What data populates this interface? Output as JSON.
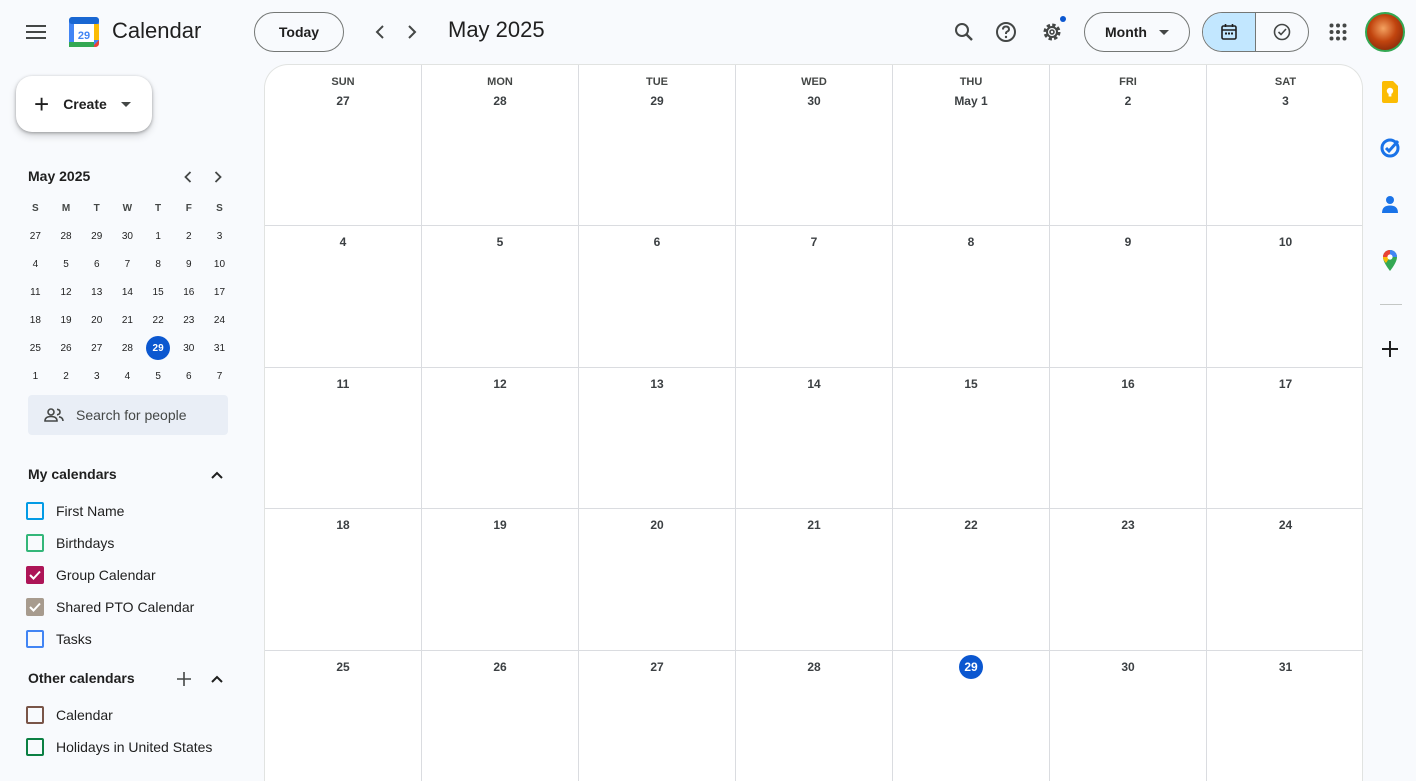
{
  "header": {
    "app_title": "Calendar",
    "logo_day": "29",
    "today_label": "Today",
    "month_title": "May 2025",
    "view_label": "Month",
    "colors": {
      "accent": "#0b57d0",
      "toggle_active": "#c2e7ff"
    }
  },
  "sidebar": {
    "create_label": "Create",
    "mini_calendar": {
      "title": "May 2025",
      "weekdays": [
        "S",
        "M",
        "T",
        "W",
        "T",
        "F",
        "S"
      ],
      "days": [
        "27",
        "28",
        "29",
        "30",
        "1",
        "2",
        "3",
        "4",
        "5",
        "6",
        "7",
        "8",
        "9",
        "10",
        "11",
        "12",
        "13",
        "14",
        "15",
        "16",
        "17",
        "18",
        "19",
        "20",
        "21",
        "22",
        "23",
        "24",
        "25",
        "26",
        "27",
        "28",
        "29",
        "30",
        "31",
        "1",
        "2",
        "3",
        "4",
        "5",
        "6",
        "7"
      ],
      "selected_index": 32
    },
    "people_search_placeholder": "Search for people",
    "my_calendars": {
      "title": "My calendars",
      "items": [
        {
          "label": "First Name",
          "color": "#039be5",
          "checked": false
        },
        {
          "label": "Birthdays",
          "color": "#33b679",
          "checked": false
        },
        {
          "label": "Group Calendar",
          "color": "#ad1457",
          "checked": true
        },
        {
          "label": "Shared PTO Calendar",
          "color": "#a79b8e",
          "checked": true
        },
        {
          "label": "Tasks",
          "color": "#4285f4",
          "checked": false
        }
      ]
    },
    "other_calendars": {
      "title": "Other calendars",
      "items": [
        {
          "label": "Calendar",
          "color": "#795548",
          "checked": false
        },
        {
          "label": "Holidays in United States",
          "color": "#0b8043",
          "checked": false
        }
      ]
    }
  },
  "month_grid": {
    "weekdays": [
      "SUN",
      "MON",
      "TUE",
      "WED",
      "THU",
      "FRI",
      "SAT"
    ],
    "weeks": [
      [
        "27",
        "28",
        "29",
        "30",
        "May 1",
        "2",
        "3"
      ],
      [
        "4",
        "5",
        "6",
        "7",
        "8",
        "9",
        "10"
      ],
      [
        "11",
        "12",
        "13",
        "14",
        "15",
        "16",
        "17"
      ],
      [
        "18",
        "19",
        "20",
        "21",
        "22",
        "23",
        "24"
      ],
      [
        "25",
        "26",
        "27",
        "28",
        "29",
        "30",
        "31"
      ]
    ],
    "today": {
      "week": 4,
      "day": 4
    }
  },
  "right_rail": {
    "icons": [
      "keep-icon",
      "tasks-icon",
      "contacts-icon",
      "maps-icon",
      "add-icon"
    ]
  }
}
